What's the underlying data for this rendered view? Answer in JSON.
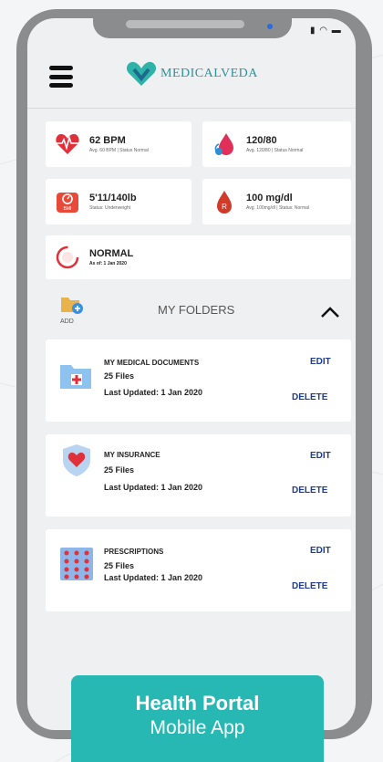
{
  "app": {
    "brand": "MEDICALVEDA"
  },
  "vitals": [
    {
      "value": "62 BPM",
      "sub": "Avg. 60 BPM | Status Normal",
      "icon": "heartbeat-icon"
    },
    {
      "value": "120/80",
      "sub": "Avg. 120/80 | Status Normal",
      "icon": "blood-pressure-icon"
    },
    {
      "value": "5'11/140lb",
      "sub": "Status: Underweight",
      "icon": "bmi-icon"
    },
    {
      "value": "100 mg/dl",
      "sub": "Avg. 100mg/dl | Status: Normal",
      "icon": "blood-sugar-icon"
    }
  ],
  "overall": {
    "status": "NORMAL",
    "asof": "As of: 1 Jan 2020"
  },
  "folders": {
    "title": "MY FOLDERS",
    "add_label": "ADD",
    "items": [
      {
        "name": "MY MEDICAL DOCUMENTS",
        "count": "25 Files",
        "updated": "Last Updated: 1 Jan 2020",
        "edit": "EDIT",
        "delete": "DELETE"
      },
      {
        "name": "MY INSURANCE",
        "count": "25 Files",
        "updated": "Last Updated: 1 Jan 2020",
        "edit": "EDIT",
        "delete": "DELETE"
      },
      {
        "name": "PRESCRIPTIONS",
        "count": "25 Files",
        "updated": "Last Updated: 1 Jan 2020",
        "edit": "EDIT",
        "delete": "DELETE"
      }
    ]
  },
  "badge": {
    "line1": "Health Portal",
    "line2": "Mobile App"
  },
  "colors": {
    "accent": "#28b8b4",
    "link": "#1e3d8f",
    "heart": "#e0303a",
    "brand": "#2f8f9a"
  }
}
